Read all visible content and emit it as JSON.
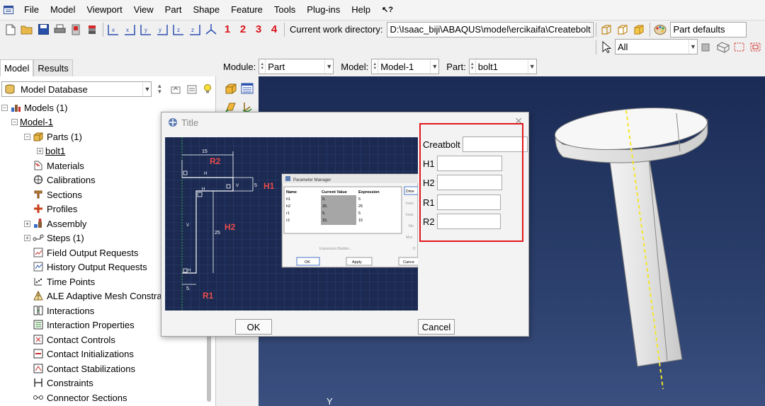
{
  "menubar": {
    "items": [
      "File",
      "Model",
      "Viewport",
      "View",
      "Part",
      "Shape",
      "Feature",
      "Tools",
      "Plug-ins",
      "Help",
      "↖?"
    ]
  },
  "toolbar": {
    "view_numbers": [
      "1",
      "2",
      "3",
      "4"
    ],
    "cwd_label": "Current work directory:",
    "cwd_value": "D:\\Isaac_biji\\ABAQUS\\model\\ercikaifa\\Createbolt",
    "part_defaults": "Part defaults"
  },
  "selection": {
    "filter_value": "All"
  },
  "tabs": {
    "model": "Model",
    "results": "Results"
  },
  "context": {
    "module_label": "Module:",
    "module_value": "Part",
    "model_label": "Model:",
    "model_value": "Model-1",
    "part_label": "Part:",
    "part_value": "bolt1"
  },
  "tree": {
    "database": "Model Database",
    "models": "Models (1)",
    "model1": "Model-1",
    "parts": "Parts (1)",
    "bolt1": "bolt1",
    "items": [
      "Materials",
      "Calibrations",
      "Sections",
      "Profiles",
      "Assembly",
      "Steps (1)",
      "Field Output Requests",
      "History Output Requests",
      "Time Points",
      "ALE Adaptive Mesh Constrain",
      "Interactions",
      "Interaction Properties",
      "Contact Controls",
      "Contact Initializations",
      "Contact Stabilizations",
      "Constraints",
      "Connector Sections"
    ]
  },
  "dialog": {
    "title": "Title",
    "form": {
      "creatbolt_label": "Creatbolt",
      "h1_label": "H1",
      "h2_label": "H2",
      "r1_label": "R1",
      "r2_label": "R2"
    },
    "ok_label": "OK",
    "cancel_label": "Cancel"
  },
  "sketch": {
    "dims": {
      "top": "15",
      "h1": "5",
      "h2": "25",
      "bottom": "5.",
      "h_label": "H",
      "v_label": "V"
    },
    "labels": {
      "r2": "R2",
      "h1": "H1",
      "h2": "H2",
      "r1": "R1"
    }
  },
  "param_manager": {
    "title": "Parameter Manager",
    "headers": [
      "Name",
      "Current Value",
      "Expression"
    ],
    "rows": [
      {
        "name": "h1",
        "current": "5.",
        "expr": "5"
      },
      {
        "name": "h2",
        "current": "25.",
        "expr": "25"
      },
      {
        "name": "r1",
        "current": "5.",
        "expr": "5"
      },
      {
        "name": "r2",
        "current": "15.",
        "expr": "15"
      }
    ],
    "side_buttons": [
      "Dime",
      "Inser",
      "Inser",
      "Mo",
      "Mov",
      "D"
    ],
    "expression_builder": "Expression Builder...",
    "ok": "OK",
    "apply": "Apply",
    "cancel": "Cance"
  },
  "viewport": {
    "axis_label": "Y"
  },
  "colors": {
    "accent_red": "#e3171d",
    "viewport_bg": "#1a2b55",
    "sketch_bg": "#1c2a52"
  }
}
